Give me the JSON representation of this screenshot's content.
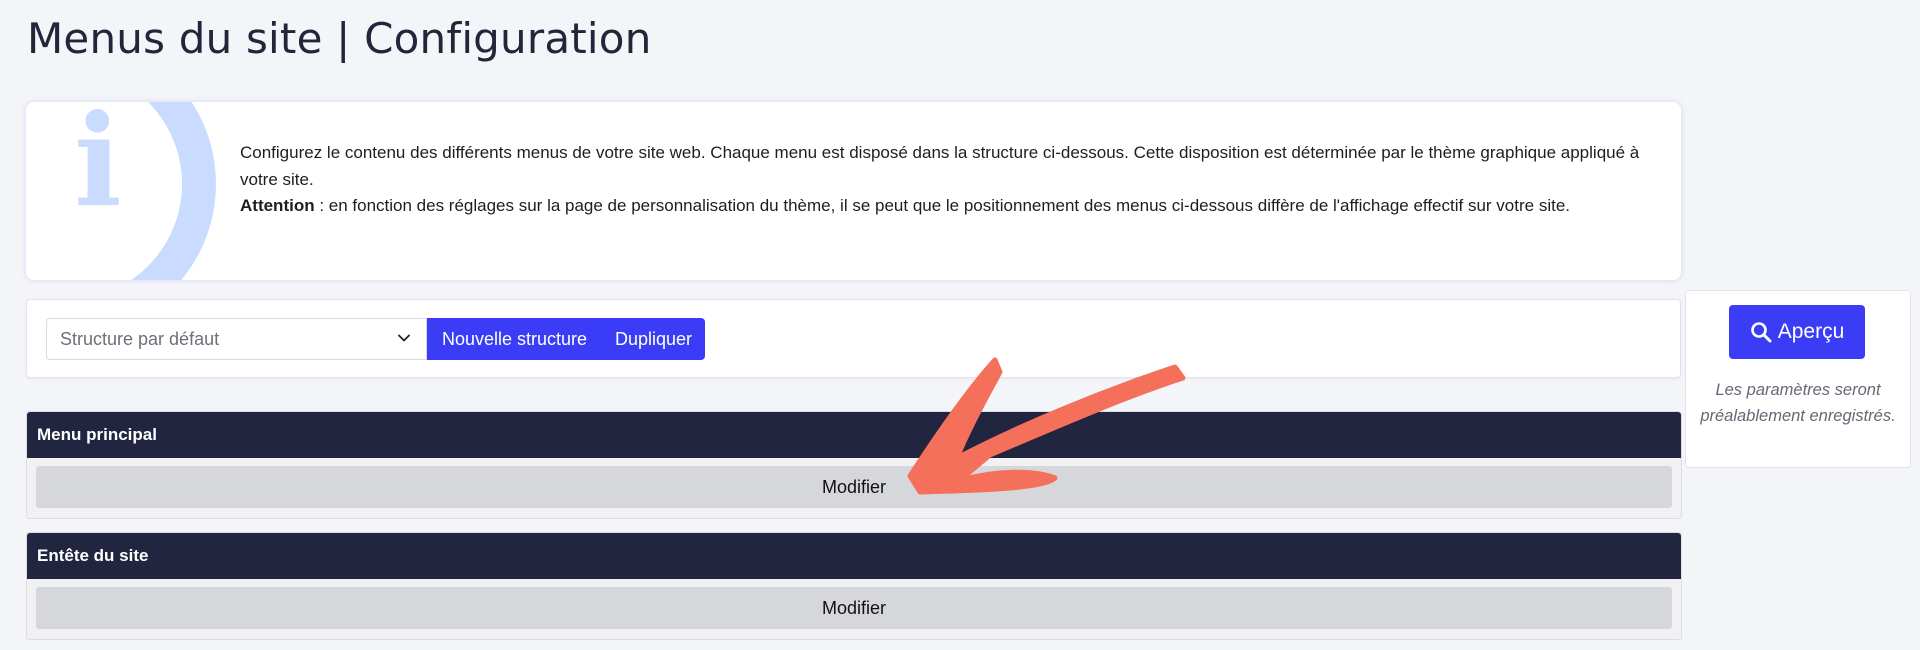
{
  "page": {
    "title": "Menus du site | Configuration"
  },
  "info": {
    "icon": "info-icon",
    "letter": "i",
    "line1": "Configurez le contenu des différents menus de votre site web. Chaque menu est disposé dans la structure ci-dessous. Cette disposition est déterminée par le thème graphique appliqué à votre site.",
    "attention_label": "Attention",
    "line2": " : en fonction des réglages sur la page de personnalisation du thème, il se peut que le positionnement des menus ci-dessous diffère de l'affichage effectif sur votre site."
  },
  "structure": {
    "select_value": "Structure par défaut",
    "new_label": "Nouvelle structure",
    "duplicate_label": "Dupliquer"
  },
  "preview": {
    "button_label": "Aperçu",
    "note": "Les paramètres seront préalablement enregistrés."
  },
  "menus": [
    {
      "title": "Menu principal",
      "action": "Modifier"
    },
    {
      "title": "Entête du site",
      "action": "Modifier"
    }
  ],
  "colors": {
    "accent": "#3b3df6",
    "header_dark": "#222540",
    "info_tint": "#c9dcff",
    "annotation_arrow": "#f4705a"
  }
}
